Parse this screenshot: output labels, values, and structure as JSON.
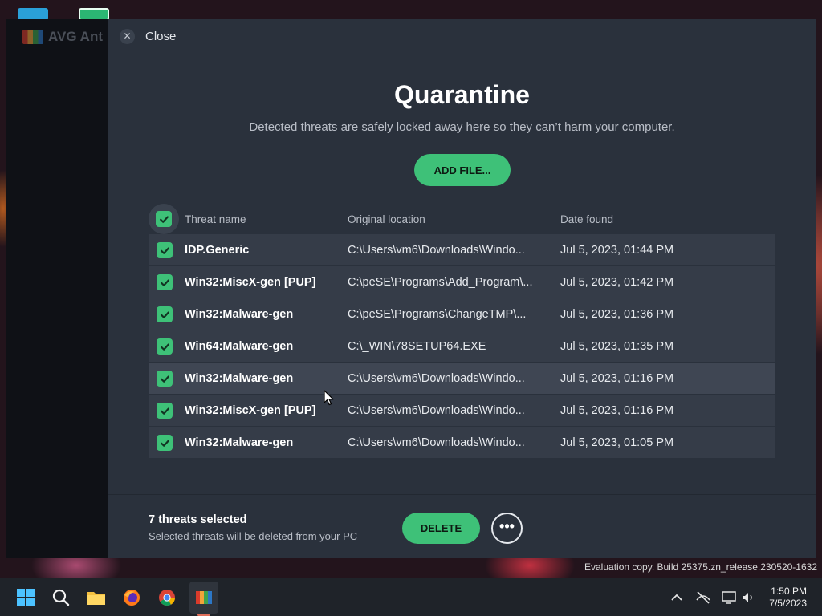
{
  "background_window": {
    "title": "AVG Ant"
  },
  "close": {
    "label": "Close"
  },
  "header": {
    "title": "Quarantine",
    "subtitle": "Detected threats are safely locked away here so they can’t harm your computer."
  },
  "add_button": {
    "label": "ADD FILE..."
  },
  "table": {
    "columns": [
      "Threat name",
      "Original location",
      "Date found"
    ],
    "rows": [
      {
        "name": "IDP.Generic",
        "location": "C:\\Users\\vm6\\Downloads\\Windo...",
        "date": "Jul 5, 2023, 01:44 PM"
      },
      {
        "name": "Win32:MiscX-gen [PUP]",
        "location": "C:\\peSE\\Programs\\Add_Program\\...",
        "date": "Jul 5, 2023, 01:42 PM"
      },
      {
        "name": "Win32:Malware-gen",
        "location": "C:\\peSE\\Programs\\ChangeTMP\\...",
        "date": "Jul 5, 2023, 01:36 PM"
      },
      {
        "name": "Win64:Malware-gen",
        "location": "C:\\_WIN\\78SETUP64.EXE",
        "date": "Jul 5, 2023, 01:35 PM"
      },
      {
        "name": "Win32:Malware-gen",
        "location": "C:\\Users\\vm6\\Downloads\\Windo...",
        "date": "Jul 5, 2023, 01:16 PM"
      },
      {
        "name": "Win32:MiscX-gen [PUP]",
        "location": "C:\\Users\\vm6\\Downloads\\Windo...",
        "date": "Jul 5, 2023, 01:16 PM"
      },
      {
        "name": "Win32:Malware-gen",
        "location": "C:\\Users\\vm6\\Downloads\\Windo...",
        "date": "Jul 5, 2023, 01:05 PM"
      }
    ]
  },
  "footer": {
    "selected_count": "7 threats selected",
    "selected_note": "Selected threats will be deleted from your PC",
    "delete_label": "DELETE",
    "more_label": "•••"
  },
  "watermark": "Evaluation copy. Build 25375.zn_release.230520-1632",
  "taskbar": {
    "icons": [
      "windows-start-icon",
      "search-icon",
      "file-explorer-icon",
      "firefox-icon",
      "chrome-icon",
      "avg-icon"
    ],
    "tray_icons": [
      "chevron-up-icon",
      "network-off-icon",
      "display-icon",
      "volume-icon"
    ],
    "time": "1:50 PM",
    "date": "7/5/2023"
  },
  "colors": {
    "accent": "#3ec178",
    "panel": "#2a313c",
    "row": "#353c48"
  }
}
